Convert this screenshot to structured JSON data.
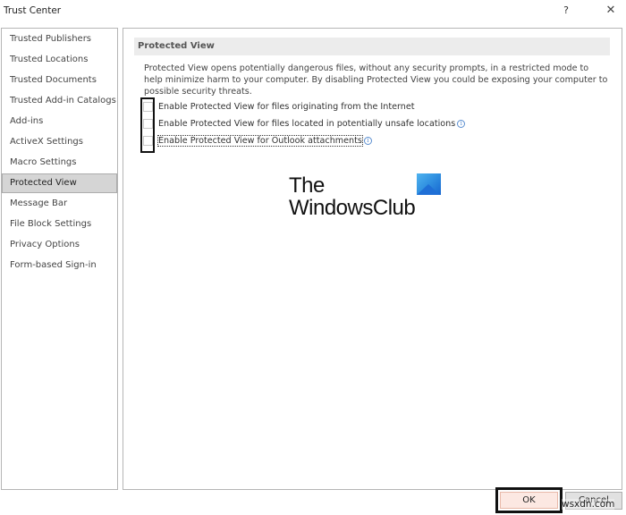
{
  "window": {
    "title": "Trust Center",
    "help_label": "?",
    "close_label": "✕"
  },
  "sidebar": {
    "items": [
      {
        "label": "Trusted Publishers",
        "active": false
      },
      {
        "label": "Trusted Locations",
        "active": false
      },
      {
        "label": "Trusted Documents",
        "active": false
      },
      {
        "label": "Trusted Add-in Catalogs",
        "active": false
      },
      {
        "label": "Add-ins",
        "active": false
      },
      {
        "label": "ActiveX Settings",
        "active": false
      },
      {
        "label": "Macro Settings",
        "active": false
      },
      {
        "label": "Protected View",
        "active": true
      },
      {
        "label": "Message Bar",
        "active": false
      },
      {
        "label": "File Block Settings",
        "active": false
      },
      {
        "label": "Privacy Options",
        "active": false
      },
      {
        "label": "Form-based Sign-in",
        "active": false
      }
    ]
  },
  "main": {
    "section_title": "Protected View",
    "description": "Protected View opens potentially dangerous files, without any security prompts, in a restricted mode to help minimize harm to your computer. By disabling Protected View you could be exposing your computer to possible security threats.",
    "options": [
      {
        "label": "Enable Protected View for files originating from the Internet",
        "checked": false,
        "info": false
      },
      {
        "label": "Enable Protected View for files located in potentially unsafe locations",
        "checked": false,
        "info": true
      },
      {
        "label": "Enable Protected View for Outlook attachments",
        "checked": false,
        "info": true
      }
    ],
    "info_glyph": "i"
  },
  "watermark": {
    "line1": "The",
    "line2": "WindowsClub"
  },
  "footer": {
    "ok_label": "OK",
    "cancel_label": "Cancel",
    "site_watermark": "wsxdn.com"
  }
}
